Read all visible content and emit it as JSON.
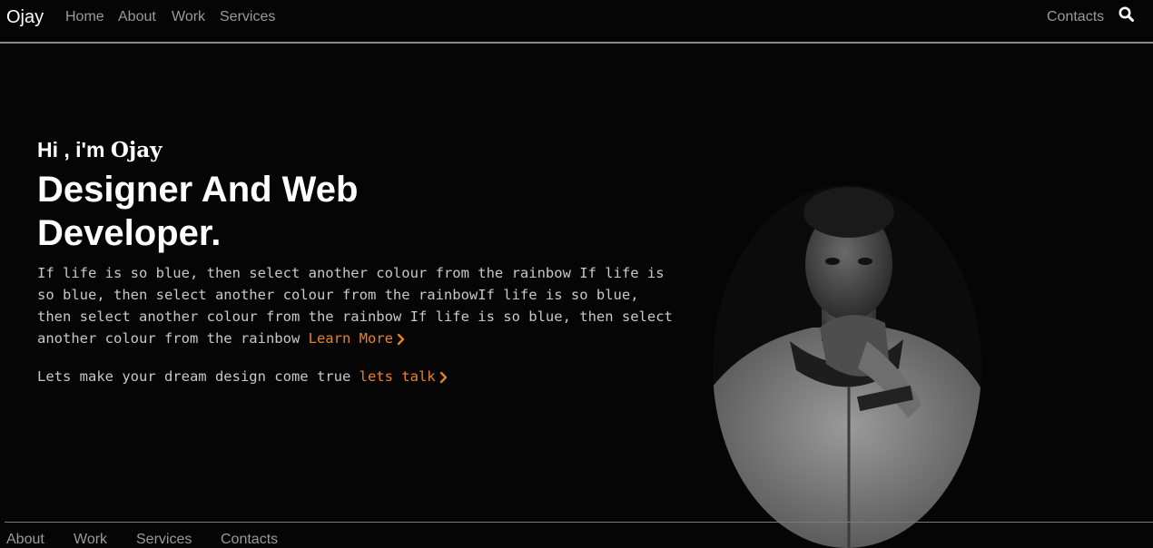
{
  "nav": {
    "brand": "Ojay",
    "links": [
      "Home",
      "About",
      "Work",
      "Services"
    ],
    "right_link": "Contacts",
    "search_icon": "search-icon"
  },
  "hero": {
    "greeting_prefix": "Hi , i'm ",
    "greeting_name": "Ojay",
    "headline_line1": "Designer And Web",
    "headline_line2": "Developer.",
    "bio": "If life is so blue, then select another colour from the rainbow If life is so blue, then select another colour from the rainbowIf life is so blue, then select another colour from the rainbow If life is so blue, then select another colour from the rainbow",
    "learn_more": "Learn More",
    "cta_text": "Lets make your dream design come true",
    "cta_link": "lets talk",
    "chevron_icon": "chevron-right-icon"
  },
  "footer": {
    "links": [
      "About",
      "Work",
      "Services",
      "Contacts"
    ]
  },
  "colors": {
    "accent": "#e8822b",
    "background": "#050505",
    "nav_text": "#9a9a9a"
  }
}
